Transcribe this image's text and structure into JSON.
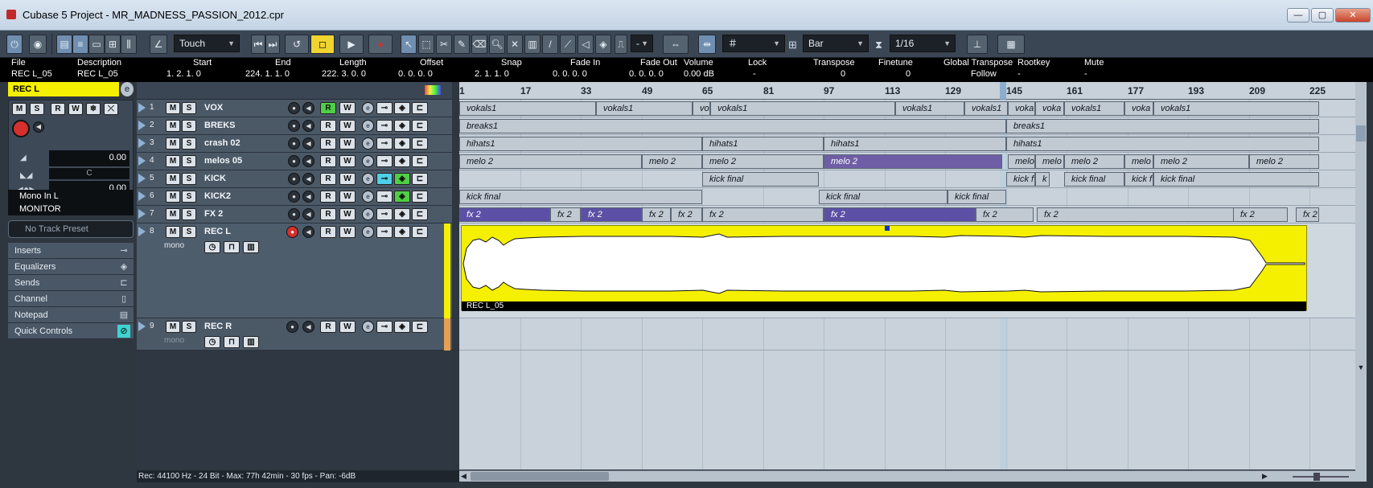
{
  "window": {
    "title": "Cubase 5 Project - MR_MADNESS_PASSION_2012.cpr",
    "minimize": "—",
    "maximize": "▢",
    "close": "✕"
  },
  "toolbar": {
    "automation_mode": "Touch",
    "snap_value": "-",
    "grid_type": "Bar",
    "quantize": "1/16"
  },
  "infoline": [
    {
      "label": "File",
      "value": "REC L_05"
    },
    {
      "label": "Description",
      "value": "REC L_05"
    },
    {
      "label": "Start",
      "value": "1. 2. 1.   0"
    },
    {
      "label": "End",
      "value": "224. 1. 1.   0"
    },
    {
      "label": "Length",
      "value": "222. 3. 0.   0"
    },
    {
      "label": "Offset",
      "value": "0. 0. 0.   0"
    },
    {
      "label": "Snap",
      "value": "2. 1. 1.   0"
    },
    {
      "label": "Fade In",
      "value": "0. 0. 0.   0"
    },
    {
      "label": "Fade Out",
      "value": "0. 0. 0.   0"
    },
    {
      "label": "Volume",
      "value": "0.00 dB"
    },
    {
      "label": "Lock",
      "value": "-"
    },
    {
      "label": "Transpose",
      "value": "0"
    },
    {
      "label": "Finetune",
      "value": "0"
    },
    {
      "label": "Global Transpose",
      "value": "Follow"
    },
    {
      "label": "Rootkey",
      "value": "-"
    },
    {
      "label": "Mute",
      "value": "-"
    }
  ],
  "inspector": {
    "track_name": "REC L",
    "volume": "0.00",
    "pan": "C",
    "delay": "0.00",
    "input": "Mono In L",
    "output": "MONITOR",
    "preset_placeholder": "No Track Preset",
    "sections": [
      "Inserts",
      "Equalizers",
      "Sends",
      "Channel",
      "Notepad",
      "Quick Controls"
    ]
  },
  "tracks": [
    {
      "num": "1",
      "name": "VOX"
    },
    {
      "num": "2",
      "name": "BREKS"
    },
    {
      "num": "3",
      "name": "crash 02"
    },
    {
      "num": "4",
      "name": "melos 05"
    },
    {
      "num": "5",
      "name": "KICK"
    },
    {
      "num": "6",
      "name": "KICK2"
    },
    {
      "num": "7",
      "name": "FX 2"
    },
    {
      "num": "8",
      "name": "REC L",
      "sub": "mono"
    },
    {
      "num": "9",
      "name": "REC R",
      "sub": "mono"
    }
  ],
  "ruler": [
    "1",
    "17",
    "33",
    "49",
    "65",
    "81",
    "97",
    "113",
    "129",
    "145",
    "161",
    "177",
    "193",
    "209",
    "225"
  ],
  "clips": {
    "vox": [
      "vokals1",
      "vokals1",
      "vok",
      "vokals1",
      "vokals1",
      "vokals1",
      "voka",
      "voka",
      "vokals1",
      "voka",
      "vokals1"
    ],
    "breaks": [
      "breaks1",
      "breaks1"
    ],
    "hihats": [
      "hihats1",
      "hihats1",
      "hihats1",
      "hihats1"
    ],
    "melo": [
      "melo 2",
      "melo 2",
      "melo 2",
      "melo 2",
      "melo",
      "melo",
      "melo 2",
      "melo",
      "melo 2",
      "melo 2"
    ],
    "kick": [
      "kick final",
      "kick f",
      "k",
      "kick final",
      "kick f",
      "kick final"
    ],
    "kick2": [
      "kick final",
      "kick final",
      "kick final"
    ],
    "fx": [
      "fx 2",
      "fx 2",
      "fx 2",
      "fx 2",
      "fx 2",
      "fx 2",
      "fx 2",
      "fx 2",
      "fx 2",
      "fx 2",
      "fx 2"
    ],
    "recl": "REC L_05"
  },
  "status": "Rec: 44100 Hz - 24 Bit - Max: 77h 42min - 30 fps - Pan: -6dB",
  "colors": {
    "accent_yellow": "#f5f000",
    "purple": "#6f5ea6",
    "record_red": "#d4302e"
  }
}
